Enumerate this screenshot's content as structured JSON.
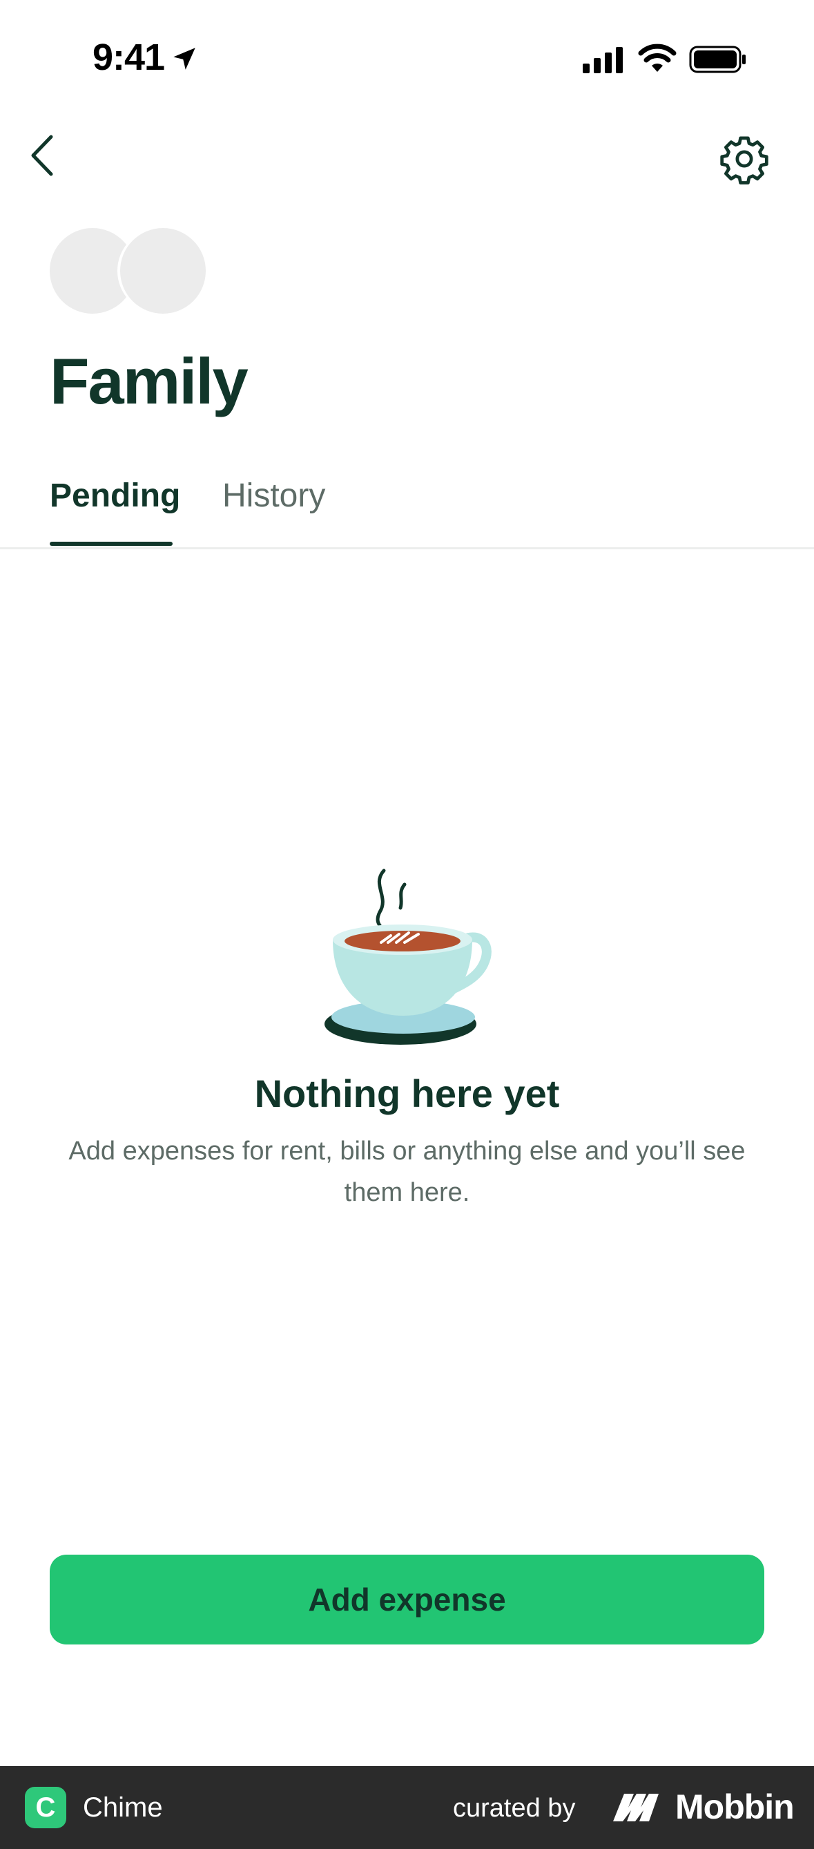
{
  "status_bar": {
    "time": "9:41"
  },
  "header": {
    "back_icon": "chevron-left-icon",
    "settings_icon": "gear-icon"
  },
  "group": {
    "title": "Family"
  },
  "tabs": [
    {
      "label": "Pending",
      "active": true
    },
    {
      "label": "History",
      "active": false
    }
  ],
  "empty_state": {
    "illustration": "coffee-cup",
    "title": "Nothing here yet",
    "body": "Add expenses for rent, bills or anything else and you’ll see them here."
  },
  "primary_action": {
    "label": "Add expense"
  },
  "footer": {
    "app_name": "Chime",
    "app_badge": "C",
    "curated_by": "curated by",
    "brand": "Mobbin"
  },
  "colors": {
    "accent": "#22c573",
    "text_dark": "#11362a",
    "text_muted": "#5d6b66"
  }
}
